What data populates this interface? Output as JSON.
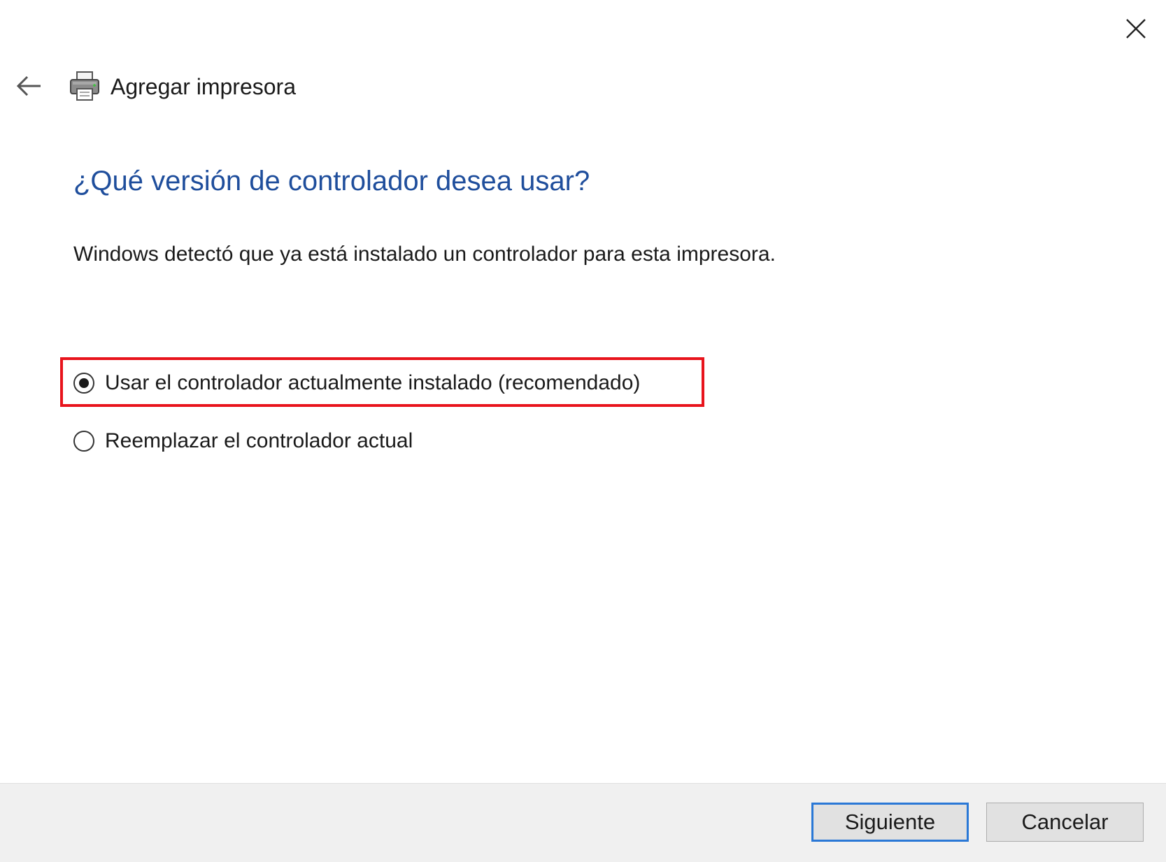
{
  "window": {
    "title": "Agregar impresora",
    "close_icon": "close-icon",
    "back_icon": "arrow-left-icon",
    "app_icon": "printer-icon"
  },
  "content": {
    "heading": "¿Qué versión de controlador desea usar?",
    "description": "Windows detectó que ya está instalado un controlador para esta impresora.",
    "options": [
      {
        "label": "Usar el controlador actualmente instalado (recomendado)",
        "selected": true
      },
      {
        "label": "Reemplazar el controlador actual",
        "selected": false
      }
    ]
  },
  "footer": {
    "next_label": "Siguiente",
    "cancel_label": "Cancelar"
  },
  "colors": {
    "heading": "#1f4e9c",
    "highlight": "#e8141c",
    "default_button_border": "#2a78d6"
  }
}
